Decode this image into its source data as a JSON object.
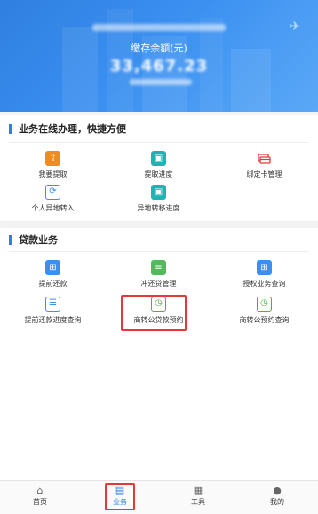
{
  "header": {
    "balance_label": "缴存余额(元)",
    "balance_value": "33,467.23"
  },
  "section_online": {
    "title": "业务在线办理，快捷方便",
    "items": [
      {
        "label": "我要提取",
        "icon": "withdraw-icon"
      },
      {
        "label": "提取进度",
        "icon": "progress-icon"
      },
      {
        "label": "绑定卡管理",
        "icon": "card-icon"
      },
      {
        "label": "个人异地转入",
        "icon": "transfer-in-icon"
      },
      {
        "label": "异地转移进度",
        "icon": "transfer-progress-icon"
      }
    ]
  },
  "section_loan": {
    "title": "贷款业务",
    "items": [
      {
        "label": "提前还款",
        "icon": "prepay-icon"
      },
      {
        "label": "冲还贷管理",
        "icon": "offset-loan-icon"
      },
      {
        "label": "授权业务查询",
        "icon": "auth-query-icon"
      },
      {
        "label": "提前还款进度查询",
        "icon": "prepay-progress-icon"
      },
      {
        "label": "商转公贷款预约",
        "icon": "commercial-to-fund-icon"
      },
      {
        "label": "商转公预约查询",
        "icon": "commercial-query-icon"
      }
    ]
  },
  "tabbar": {
    "tabs": [
      {
        "label": "首页",
        "icon": "home-icon"
      },
      {
        "label": "业务",
        "icon": "briefcase-icon"
      },
      {
        "label": "工具",
        "icon": "toolbox-icon"
      },
      {
        "label": "我的",
        "icon": "user-icon"
      }
    ],
    "active_index": 1
  },
  "colors": {
    "accent": "#2f7fe0",
    "highlight": "#e53935"
  }
}
